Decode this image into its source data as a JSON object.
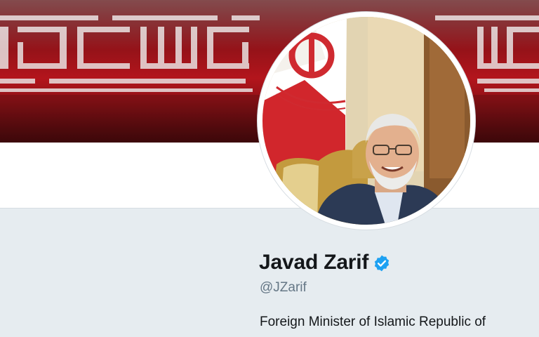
{
  "profile": {
    "display_name": "Javad Zarif",
    "handle": "@JZarif",
    "bio": "Foreign Minister of Islamic Republic of",
    "verified": true
  },
  "icons": {
    "verified": "verified-badge-icon",
    "banner": "kufic-pattern-banner",
    "avatar": "profile-photo"
  },
  "colors": {
    "banner_red": "#b3151c",
    "background": "#e6ecf0",
    "verified_blue": "#1da1f2",
    "name_text": "#14171a",
    "handle_text": "#657786"
  }
}
